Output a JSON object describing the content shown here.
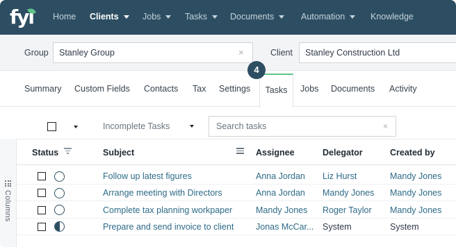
{
  "nav": {
    "logo": "fyi",
    "items": [
      {
        "label": "Home",
        "dropdown": false,
        "active": false
      },
      {
        "label": "Clients",
        "dropdown": true,
        "active": true
      },
      {
        "label": "Jobs",
        "dropdown": true,
        "active": false
      },
      {
        "label": "Tasks",
        "dropdown": true,
        "active": false
      },
      {
        "label": "Documents",
        "dropdown": true,
        "active": false
      },
      {
        "label": "Automation",
        "dropdown": true,
        "active": false
      },
      {
        "label": "Knowledge",
        "dropdown": false,
        "active": false
      }
    ]
  },
  "context": {
    "group_label": "Group",
    "group_value": "Stanley Group",
    "client_label": "Client",
    "client_value": "Stanley Construction Ltd",
    "clear_glyph": "×"
  },
  "step_badge": "4",
  "tabs": [
    "Summary",
    "Custom Fields",
    "Contacts",
    "Tax",
    "Settings",
    "Tasks",
    "Jobs",
    "Documents",
    "Activity"
  ],
  "active_tab": "Tasks",
  "toolbar": {
    "filter_value": "Incomplete Tasks",
    "search_placeholder": "Search tasks",
    "clear_glyph": "×"
  },
  "sidebar": {
    "columns_label": "Columns"
  },
  "table": {
    "columns": [
      "Status",
      "Subject",
      "Assignee",
      "Delegator",
      "Created by"
    ],
    "rows": [
      {
        "status": "not-started",
        "subject": "Follow up latest figures",
        "assignee": "Anna Jordan",
        "delegator": "Liz Hurst",
        "created_by": "Mandy Jones"
      },
      {
        "status": "not-started",
        "subject": "Arrange meeting with Directors",
        "assignee": "Anna Jordan",
        "delegator": "Mandy Jones",
        "created_by": "Mandy Jones"
      },
      {
        "status": "not-started",
        "subject": "Complete tax planning workpaper",
        "assignee": "Mandy Jones",
        "delegator": "Roger Taylor",
        "created_by": "Mandy Jones"
      },
      {
        "status": "in-progress",
        "subject": "Prepare and send invoice to client",
        "assignee": "Jonas McCar...",
        "delegator": "System",
        "created_by": "System"
      }
    ]
  },
  "colors": {
    "nav_bg": "#2d4e62",
    "accent_green": "#5fc38a",
    "link_blue": "#2e6b88"
  }
}
